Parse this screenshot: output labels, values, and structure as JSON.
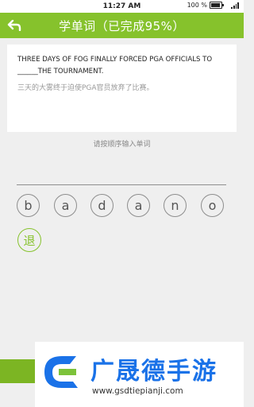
{
  "statusbar": {
    "time": "11:27 AM",
    "battery": "100 %"
  },
  "header": {
    "title": "学单词（已完成95%）",
    "accent": "#86c22c"
  },
  "question": {
    "english": "THREE DAYS OF FOG FINALLY FORCED PGA OFFICIALS TO ______THE TOURNAMENT.",
    "chinese": "三天的大雾终于迫使PGA官员放弃了比赛。"
  },
  "hint": "请按顺序输入单词",
  "letters": [
    "b",
    "a",
    "d",
    "a",
    "n",
    "o"
  ],
  "backspace_label": "退",
  "watermark": {
    "name": "广晟德手游",
    "url": "www.gsdtiepianji.com"
  }
}
